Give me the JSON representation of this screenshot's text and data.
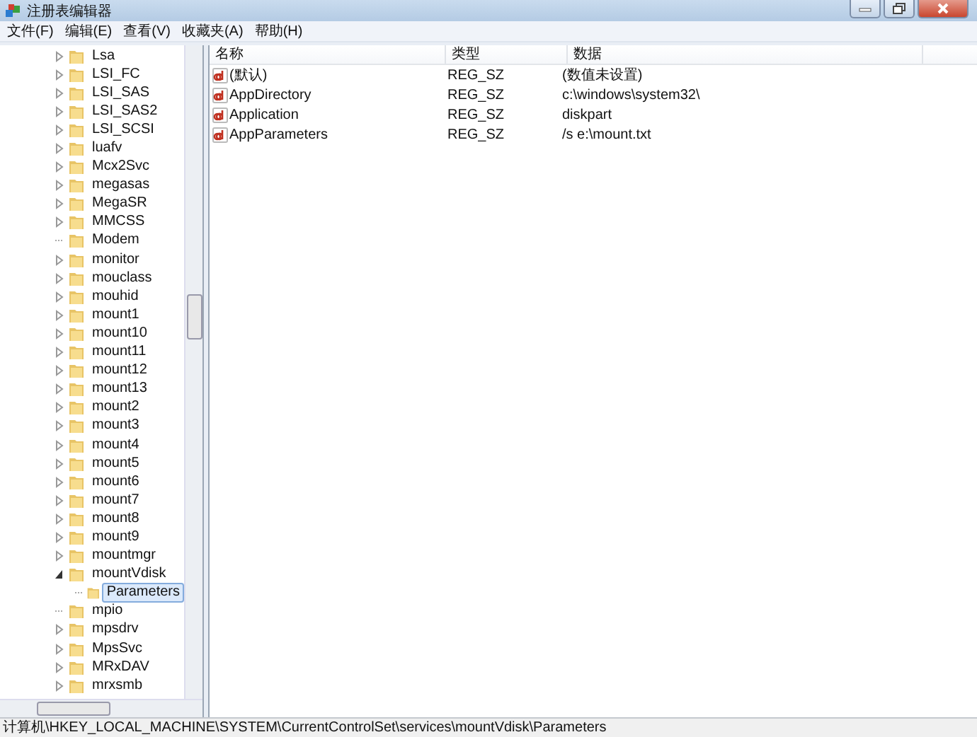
{
  "window": {
    "title": "注册表编辑器"
  },
  "menu": [
    "文件(F)",
    "编辑(E)",
    "查看(V)",
    "收藏夹(A)",
    "帮助(H)"
  ],
  "tree": [
    {
      "label": "Lsa",
      "expandable": true,
      "expanded": false,
      "selected": false
    },
    {
      "label": "LSI_FC",
      "expandable": true,
      "expanded": false,
      "selected": false
    },
    {
      "label": "LSI_SAS",
      "expandable": true,
      "expanded": false,
      "selected": false
    },
    {
      "label": "LSI_SAS2",
      "expandable": true,
      "expanded": false,
      "selected": false
    },
    {
      "label": "LSI_SCSI",
      "expandable": true,
      "expanded": false,
      "selected": false
    },
    {
      "label": "luafv",
      "expandable": true,
      "expanded": false,
      "selected": false
    },
    {
      "label": "Mcx2Svc",
      "expandable": true,
      "expanded": false,
      "selected": false
    },
    {
      "label": "megasas",
      "expandable": true,
      "expanded": false,
      "selected": false
    },
    {
      "label": "MegaSR",
      "expandable": true,
      "expanded": false,
      "selected": false
    },
    {
      "label": "MMCSS",
      "expandable": true,
      "expanded": false,
      "selected": false
    },
    {
      "label": "Modem",
      "expandable": false,
      "selected": false
    },
    {
      "label": "monitor",
      "expandable": true,
      "expanded": false,
      "selected": false
    },
    {
      "label": "mouclass",
      "expandable": true,
      "expanded": false,
      "selected": false
    },
    {
      "label": "mouhid",
      "expandable": true,
      "expanded": false,
      "selected": false
    },
    {
      "label": "mount1",
      "expandable": true,
      "expanded": false,
      "selected": false
    },
    {
      "label": "mount10",
      "expandable": true,
      "expanded": false,
      "selected": false
    },
    {
      "label": "mount11",
      "expandable": true,
      "expanded": false,
      "selected": false
    },
    {
      "label": "mount12",
      "expandable": true,
      "expanded": false,
      "selected": false
    },
    {
      "label": "mount13",
      "expandable": true,
      "expanded": false,
      "selected": false
    },
    {
      "label": "mount2",
      "expandable": true,
      "expanded": false,
      "selected": false
    },
    {
      "label": "mount3",
      "expandable": true,
      "expanded": false,
      "selected": false
    },
    {
      "label": "mount4",
      "expandable": true,
      "expanded": false,
      "selected": false
    },
    {
      "label": "mount5",
      "expandable": true,
      "expanded": false,
      "selected": false
    },
    {
      "label": "mount6",
      "expandable": true,
      "expanded": false,
      "selected": false
    },
    {
      "label": "mount7",
      "expandable": true,
      "expanded": false,
      "selected": false
    },
    {
      "label": "mount8",
      "expandable": true,
      "expanded": false,
      "selected": false
    },
    {
      "label": "mount9",
      "expandable": true,
      "expanded": false,
      "selected": false
    },
    {
      "label": "mountmgr",
      "expandable": true,
      "expanded": false,
      "selected": false
    },
    {
      "label": "mountVdisk",
      "expandable": true,
      "expanded": true,
      "selected": false,
      "children": [
        {
          "label": "Parameters",
          "expandable": false,
          "selected": true
        }
      ]
    },
    {
      "label": "mpio",
      "expandable": false,
      "selected": false
    },
    {
      "label": "mpsdrv",
      "expandable": true,
      "expanded": false,
      "selected": false
    },
    {
      "label": "MpsSvc",
      "expandable": true,
      "expanded": false,
      "selected": false
    },
    {
      "label": "MRxDAV",
      "expandable": true,
      "expanded": false,
      "selected": false
    },
    {
      "label": "mrxsmb",
      "expandable": true,
      "expanded": false,
      "selected": false
    }
  ],
  "table": {
    "columns": [
      "名称",
      "类型",
      "数据"
    ],
    "rows": [
      {
        "name": "(默认)",
        "type": "REG_SZ",
        "data": "(数值未设置)"
      },
      {
        "name": "AppDirectory",
        "type": "REG_SZ",
        "data": "c:\\windows\\system32\\"
      },
      {
        "name": "Application",
        "type": "REG_SZ",
        "data": "diskpart"
      },
      {
        "name": "AppParameters",
        "type": "REG_SZ",
        "data": "/s e:\\mount.txt"
      }
    ]
  },
  "status_bar": "计算机\\HKEY_LOCAL_MACHINE\\SYSTEM\\CurrentControlSet\\services\\mountVdisk\\Parameters"
}
